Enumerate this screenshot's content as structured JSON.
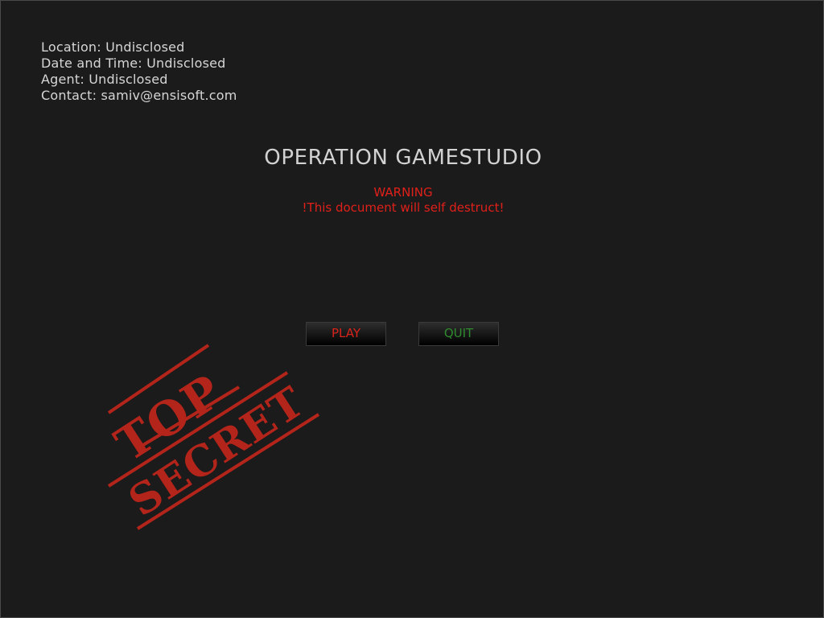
{
  "info": {
    "location": "Location: Undisclosed",
    "datetime": "Date and Time: Undisclosed",
    "agent": "Agent: Undisclosed",
    "contact": "Contact: samiv@ensisoft.com"
  },
  "title": "OPERATION GAMESTUDIO",
  "warning": {
    "heading": "WARNING",
    "message": "!This document will self destruct!"
  },
  "buttons": {
    "play": "PLAY",
    "quit": "QUIT"
  },
  "stamp": {
    "line1": "TOP",
    "line2": "SECRET",
    "color": "#b3241a"
  },
  "colors": {
    "background": "#1b1b1b",
    "text": "#d6d6d6",
    "warning": "#e0201a",
    "play": "#d8231b",
    "quit": "#2f8b2e"
  }
}
